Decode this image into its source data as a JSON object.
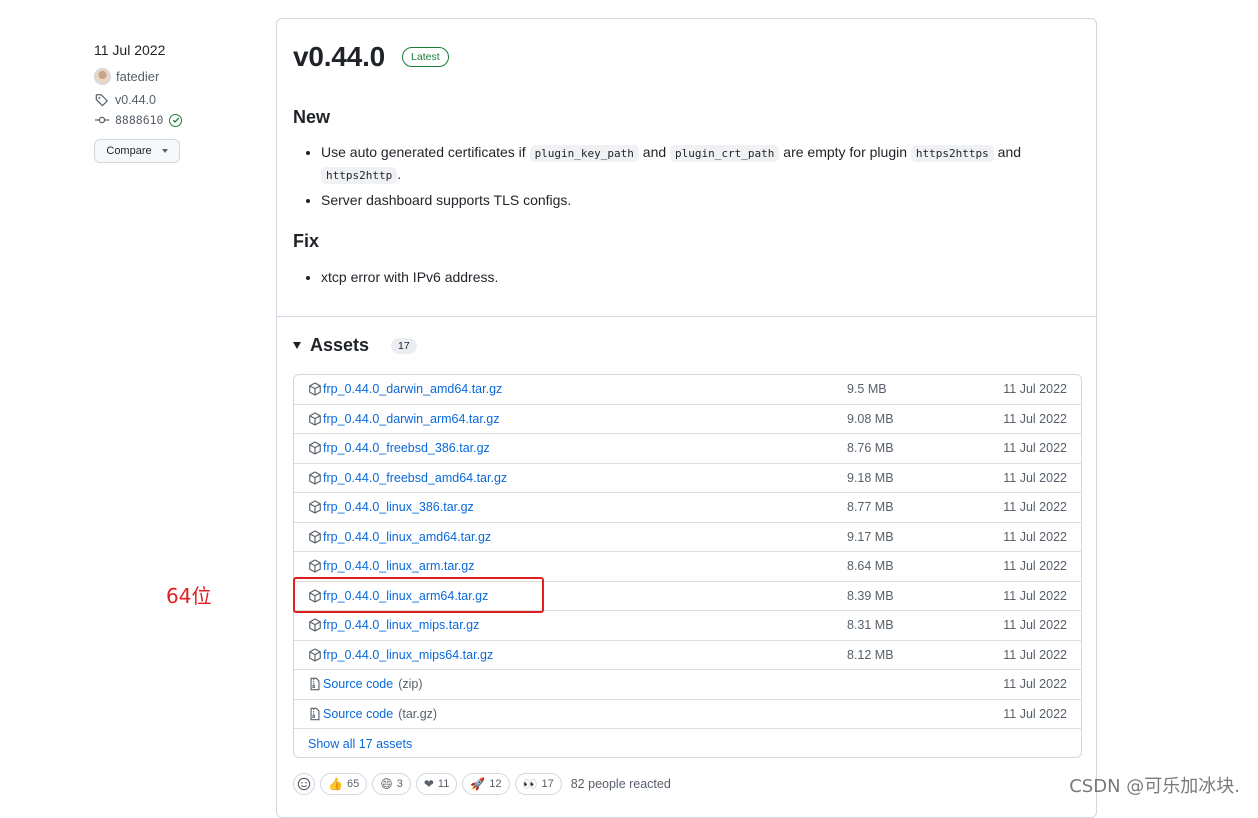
{
  "meta": {
    "date": "11 Jul 2022",
    "author": "fatedier",
    "tag": "v0.44.0",
    "commit": "8888610",
    "compare_label": "Compare"
  },
  "release": {
    "title": "v0.44.0",
    "badge": "Latest",
    "new_heading": "New",
    "new_items": [
      {
        "before": "Use auto generated certificates if ",
        "code1": "plugin_key_path",
        "mid1": " and ",
        "code2": "plugin_crt_path",
        "mid2": " are empty for plugin ",
        "code3": "https2https",
        "mid3": " and ",
        "code4": "https2http",
        "after": "."
      },
      {
        "text": "Server dashboard supports TLS configs."
      }
    ],
    "fix_heading": "Fix",
    "fix_items": [
      {
        "text": "xtcp error with IPv6 address."
      }
    ]
  },
  "assets": {
    "title": "Assets",
    "count": "17",
    "rows": [
      {
        "name": "frp_0.44.0_darwin_amd64.tar.gz",
        "size": "9.5 MB",
        "date": "11 Jul 2022",
        "icon": "package-icon"
      },
      {
        "name": "frp_0.44.0_darwin_arm64.tar.gz",
        "size": "9.08 MB",
        "date": "11 Jul 2022",
        "icon": "package-icon"
      },
      {
        "name": "frp_0.44.0_freebsd_386.tar.gz",
        "size": "8.76 MB",
        "date": "11 Jul 2022",
        "icon": "package-icon"
      },
      {
        "name": "frp_0.44.0_freebsd_amd64.tar.gz",
        "size": "9.18 MB",
        "date": "11 Jul 2022",
        "icon": "package-icon"
      },
      {
        "name": "frp_0.44.0_linux_386.tar.gz",
        "size": "8.77 MB",
        "date": "11 Jul 2022",
        "icon": "package-icon"
      },
      {
        "name": "frp_0.44.0_linux_amd64.tar.gz",
        "size": "9.17 MB",
        "date": "11 Jul 2022",
        "icon": "package-icon"
      },
      {
        "name": "frp_0.44.0_linux_arm.tar.gz",
        "size": "8.64 MB",
        "date": "11 Jul 2022",
        "icon": "package-icon"
      },
      {
        "name": "frp_0.44.0_linux_arm64.tar.gz",
        "size": "8.39 MB",
        "date": "11 Jul 2022",
        "icon": "package-icon"
      },
      {
        "name": "frp_0.44.0_linux_mips.tar.gz",
        "size": "8.31 MB",
        "date": "11 Jul 2022",
        "icon": "package-icon"
      },
      {
        "name": "frp_0.44.0_linux_mips64.tar.gz",
        "size": "8.12 MB",
        "date": "11 Jul 2022",
        "icon": "package-icon"
      },
      {
        "name": "Source code",
        "suffix": "(zip)",
        "size": "",
        "date": "11 Jul 2022",
        "icon": "file-zip-icon"
      },
      {
        "name": "Source code",
        "suffix": "(tar.gz)",
        "size": "",
        "date": "11 Jul 2022",
        "icon": "file-zip-icon"
      }
    ],
    "show_all": "Show all 17 assets"
  },
  "reactions": {
    "items": [
      {
        "emoji": "👍",
        "count": "65",
        "name": "thumbs-up"
      },
      {
        "emoji": "😄",
        "count": "3",
        "name": "laugh"
      },
      {
        "emoji": "❤",
        "count": "11",
        "name": "heart"
      },
      {
        "emoji": "🚀",
        "count": "12",
        "name": "rocket"
      },
      {
        "emoji": "👀",
        "count": "17",
        "name": "eyes"
      }
    ],
    "summary": "82 people reacted"
  },
  "annotation": {
    "label": "64位",
    "color": "#e02020"
  },
  "watermark": "CSDN @可乐加冰块."
}
